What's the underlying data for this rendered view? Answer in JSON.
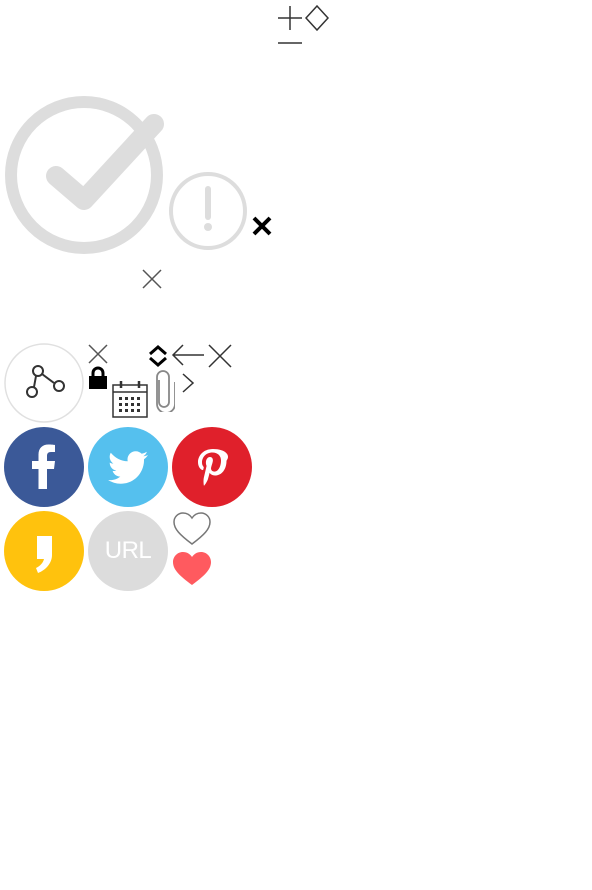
{
  "icons": {
    "plus": "plus-icon",
    "minus": "minus-icon",
    "diamond": "diamond-sort-icon",
    "check_circle": "check-circle-icon",
    "alert_circle": "exclamation-circle-icon",
    "close_bold": "close-bold-icon",
    "close_thin": "close-icon",
    "share": "share-icon",
    "lock": "lock-icon",
    "calendar": "calendar-icon",
    "paperclip": "paperclip-icon",
    "chevron_right": "chevron-right-icon",
    "chevron_updown": "chevron-up-down-icon",
    "arrow_left": "arrow-left-icon",
    "facebook": "facebook-icon",
    "twitter": "twitter-icon",
    "pinterest": "pinterest-icon",
    "kakao": "kakaostory-icon",
    "heart_outline": "heart-outline-icon",
    "heart_filled": "heart-filled-icon"
  },
  "share": {
    "url_label": "URL"
  },
  "colors": {
    "facebook": "#3b5998",
    "twitter": "#55c0ee",
    "pinterest": "#e0202b",
    "kakao": "#ffc20d",
    "url": "#dcdcdc",
    "heart": "#ff5a5f",
    "faded": "#dddddd",
    "line": "#333333"
  }
}
